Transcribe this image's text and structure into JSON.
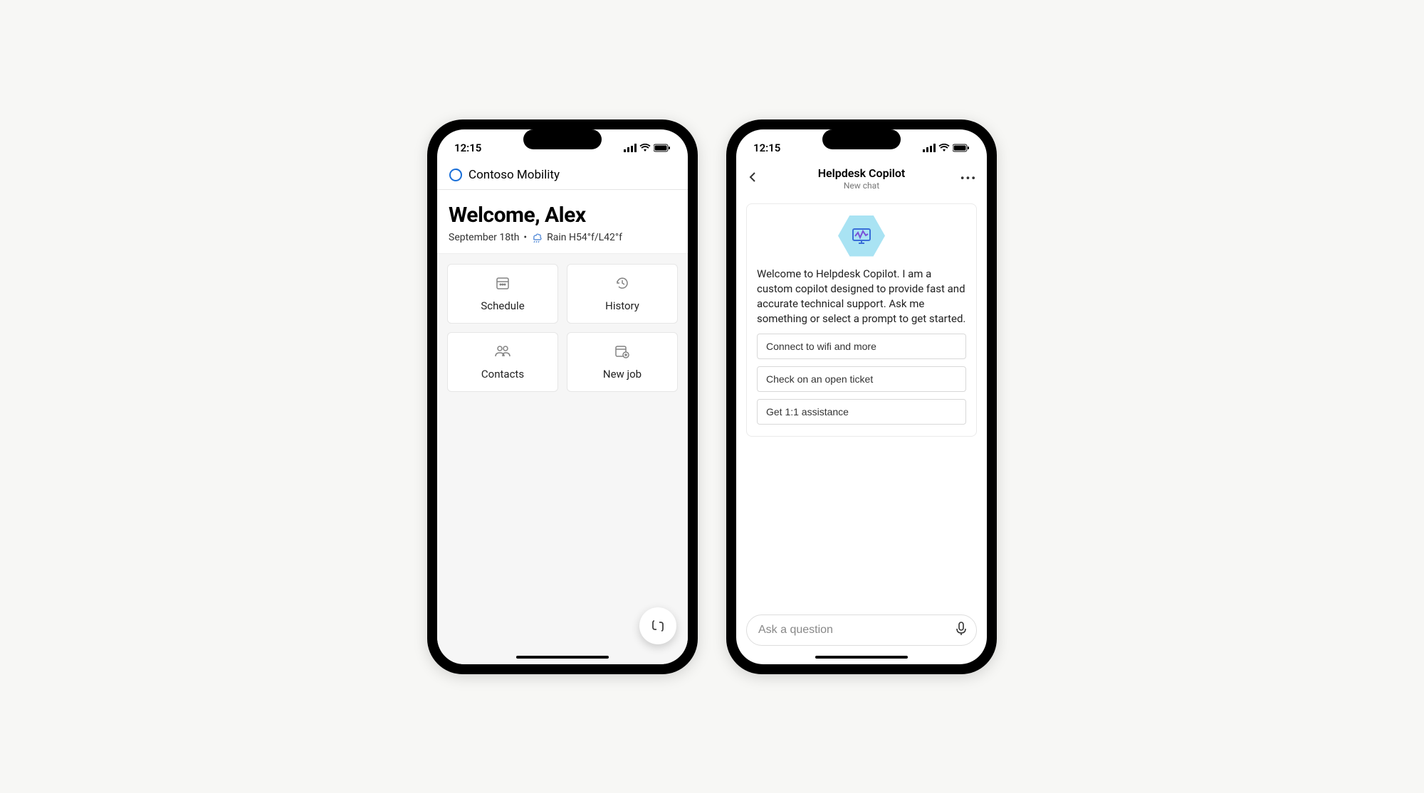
{
  "status": {
    "time": "12:15"
  },
  "phone1": {
    "app_title": "Contoso Mobility",
    "welcome_title": "Welcome, Alex",
    "date": "September 18th",
    "weather_text": "Rain H54°f/L42°f",
    "tiles": [
      {
        "label": "Schedule"
      },
      {
        "label": "History"
      },
      {
        "label": "Contacts"
      },
      {
        "label": "New job"
      }
    ]
  },
  "phone2": {
    "title": "Helpdesk Copilot",
    "subtitle": "New chat",
    "intro": "Welcome to Helpdesk Copilot. I am a custom copilot designed to provide fast and accurate technical support. Ask me something or select a prompt to get started.",
    "prompts": [
      "Connect to wifi and more",
      "Check on an open ticket",
      "Get 1:1 assistance"
    ],
    "input_placeholder": "Ask a question"
  }
}
